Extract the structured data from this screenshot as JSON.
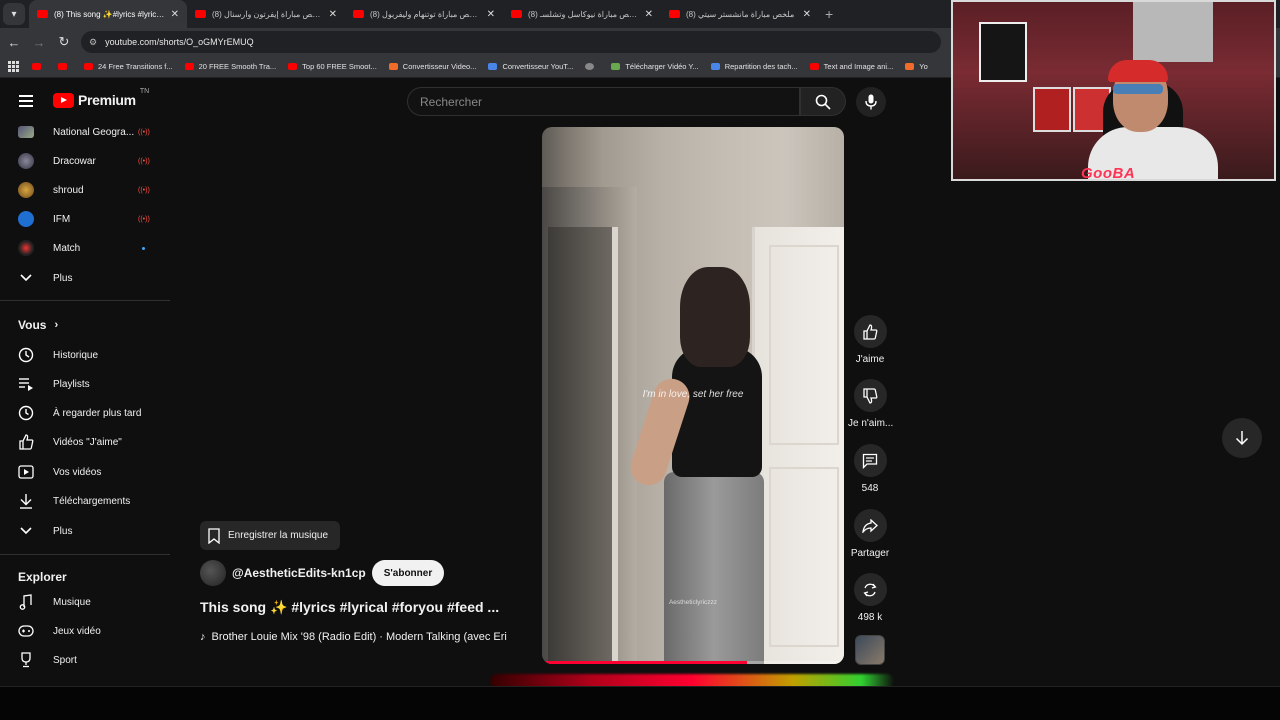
{
  "browser": {
    "tabs": [
      {
        "title": "(8) This song ✨#lyrics #lyrical #",
        "active": true
      },
      {
        "title": "(8) ملخص مباراة إيفرتون وآرسنال",
        "active": false
      },
      {
        "title": "(8) ملخص مباراة توتنهام وليفربول",
        "active": false
      },
      {
        "title": "(8) ملخص مباراة نيوكاسل وتشلسـ",
        "active": false
      },
      {
        "title": "(8) ملخص مباراة مانشستر سيتي",
        "active": false
      }
    ],
    "url": "youtube.com/shorts/O_oGMYrEMUQ",
    "bookmarks": [
      {
        "label": "",
        "icon": "youtube-icon"
      },
      {
        "label": "",
        "icon": "youtube-icon"
      },
      {
        "label": "24 Free Transitions f...",
        "icon": "youtube-icon"
      },
      {
        "label": "20 FREE Smooth Tra...",
        "icon": "youtube-icon"
      },
      {
        "label": "Top 60 FREE Smoot...",
        "icon": "youtube-icon"
      },
      {
        "label": "Convertisseur Video...",
        "icon": "z-icon"
      },
      {
        "label": "Convertisseur YouT...",
        "icon": "converter-icon"
      },
      {
        "label": "",
        "icon": "globe-icon"
      },
      {
        "label": "Télécharger Vidéo Y...",
        "icon": "download-icon"
      },
      {
        "label": "Repartition des tach...",
        "icon": "doc-icon"
      },
      {
        "label": "Text and Image ani...",
        "icon": "youtube-icon"
      },
      {
        "label": "Yo",
        "icon": "star-icon"
      }
    ]
  },
  "masthead": {
    "logo": "Premium",
    "logo_suffix": "TN",
    "search_placeholder": "Rechercher"
  },
  "sidebar": {
    "subscriptions": [
      {
        "label": "National Geogra...",
        "indicator": "live"
      },
      {
        "label": "Dracowar",
        "indicator": "live"
      },
      {
        "label": "shroud",
        "indicator": "live"
      },
      {
        "label": "IFM",
        "indicator": "live"
      },
      {
        "label": "Match",
        "indicator": "new"
      }
    ],
    "more_label_1": "Plus",
    "you_heading": "Vous",
    "you_items": [
      {
        "label": "Historique",
        "icon": "history-icon"
      },
      {
        "label": "Playlists",
        "icon": "playlist-icon"
      },
      {
        "label": "À regarder plus tard",
        "icon": "clock-icon"
      },
      {
        "label": "Vidéos \"J'aime\"",
        "icon": "thumb-up-icon"
      },
      {
        "label": "Vos vidéos",
        "icon": "play-icon"
      },
      {
        "label": "Téléchargements",
        "icon": "download-icon"
      }
    ],
    "more_label_2": "Plus",
    "explore_heading": "Explorer",
    "explore_items": [
      {
        "label": "Musique",
        "icon": "music-icon"
      },
      {
        "label": "Jeux vidéo",
        "icon": "gamepad-icon"
      },
      {
        "label": "Sport",
        "icon": "trophy-icon"
      }
    ]
  },
  "short": {
    "lyric_overlay": "I'm in love, set her free",
    "watermark": "Aestheticlyriczzz",
    "progress": 0.68,
    "save_music_label": "Enregistrer la musique",
    "channel": "@AestheticEdits-kn1cp",
    "subscribe_label": "S'abonner",
    "title": "This song ✨ #lyrics #lyrical #foryou #feed ...",
    "music": "Brother Louie Mix '98 (Radio Edit) · Modern Talking (avec Eri",
    "actions": {
      "like": "J'aime",
      "dislike": "Je n'aim...",
      "comments": "548",
      "share": "Partager",
      "remix": "498 k"
    }
  },
  "webcam": {
    "overlay_brand": "GooBA"
  },
  "colors": {
    "accent": "#ff0000",
    "background": "#0f0f0f",
    "live": "#ff4e45"
  }
}
